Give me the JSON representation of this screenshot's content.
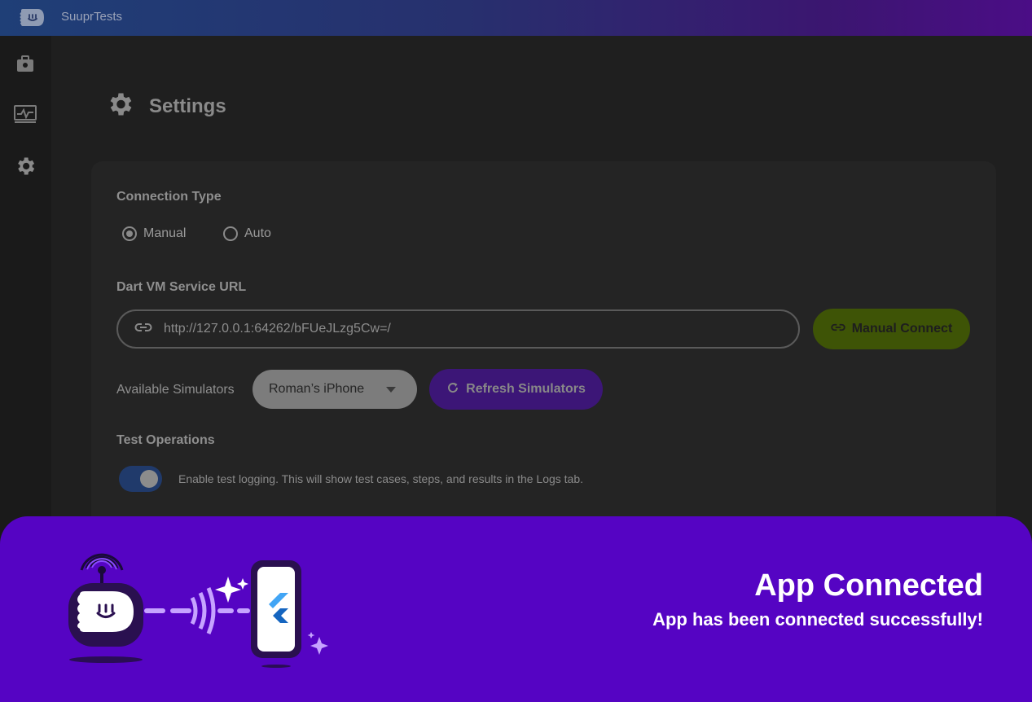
{
  "app": {
    "title": "SuuprTests"
  },
  "sidebar": {
    "items": [
      {
        "icon": "toolbox-icon"
      },
      {
        "icon": "monitor-pulse-icon"
      },
      {
        "icon": "gear-icon"
      }
    ]
  },
  "page": {
    "title": "Settings",
    "icon": "gear-icon"
  },
  "connection": {
    "label": "Connection Type",
    "options": [
      "Manual",
      "Auto"
    ],
    "selected": "Manual"
  },
  "vm": {
    "label": "Dart VM Service URL",
    "url": "http://127.0.0.1:64262/bFUeJLzg5Cw=/",
    "connect_label": "Manual Connect"
  },
  "simulators": {
    "label": "Available Simulators",
    "selected": "Roman’s iPhone",
    "refresh_label": "Refresh Simulators"
  },
  "test_ops": {
    "label": "Test Operations",
    "logging_enabled": true,
    "logging_text": "Enable test logging. This will show test cases, steps, and results in the Logs tab."
  },
  "toast": {
    "title": "App Connected",
    "message": "App has been connected successfully!"
  },
  "colors": {
    "accent_purple": "#5504c3",
    "connect_green": "#3e5406",
    "refresh_purple": "#3c1677",
    "toggle_blue": "#203a6b"
  }
}
